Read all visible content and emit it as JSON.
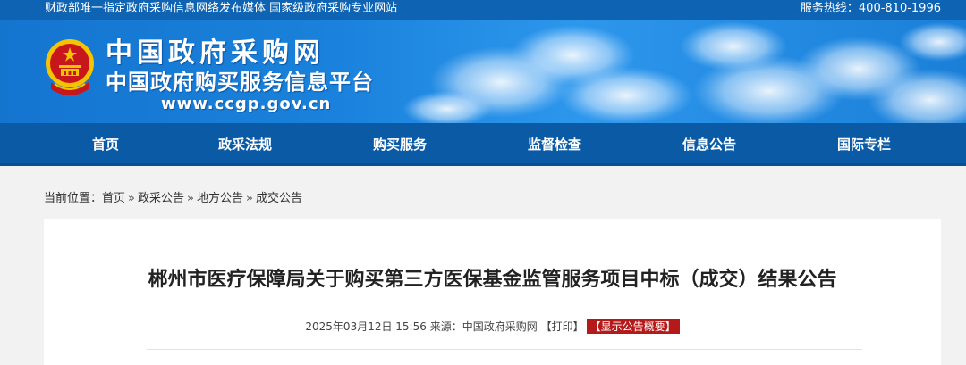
{
  "topbar": {
    "tagline": "财政部唯一指定政府采购信息网络发布媒体 国家级政府采购专业网站",
    "hotline": "服务热线：400-810-1996"
  },
  "banner": {
    "site_name": "中国政府采购网",
    "site_subtitle": "中国政府购买服务信息平台",
    "site_url": "www.ccgp.gov.cn",
    "emblem_icon": "national-emblem-icon",
    "colors": {
      "banner_blue": "#1a82dc",
      "nav_blue": "#0a5aa5",
      "emblem_red": "#c8161d",
      "emblem_gold": "#f5c400"
    }
  },
  "nav": {
    "items": [
      {
        "label": "首页"
      },
      {
        "label": "政采法规"
      },
      {
        "label": "购买服务"
      },
      {
        "label": "监督检查"
      },
      {
        "label": "信息公告"
      },
      {
        "label": "国际专栏"
      }
    ]
  },
  "breadcrumb": {
    "prefix": "当前位置：",
    "items": [
      "首页",
      "政采公告",
      "地方公告",
      "成交公告"
    ],
    "separator": "»"
  },
  "article": {
    "title": "郴州市医疗保障局关于购买第三方医保基金监管服务项目中标（成交）结果公告",
    "datetime": "2025年03月12日 15:56",
    "source_label": "来源：",
    "source": "中国政府采购网",
    "print_label": "【打印】",
    "summary_button": "【显示公告概要】"
  }
}
